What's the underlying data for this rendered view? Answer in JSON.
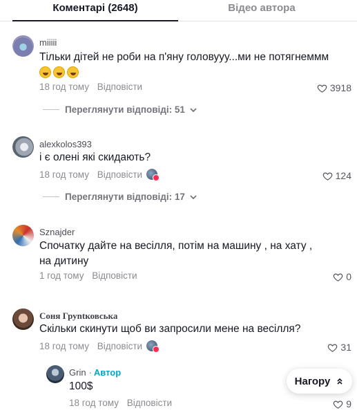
{
  "tabs": [
    {
      "label": "Коментарі (2648)",
      "active": true
    },
    {
      "label": "Відео автора",
      "active": false
    }
  ],
  "comments": [
    {
      "username": "miiiii",
      "text": "Тільки дітей не роби на п'яну головууу...ми не потягнеммм",
      "emojis": [
        "rolling-laughing-emoji",
        "rolling-laughing-emoji",
        "rolling-laughing-emoji"
      ],
      "time": "18 год тому",
      "reply_label": "Відповісти",
      "likes": "3918",
      "view_replies": "Переглянути відповіді: 51"
    },
    {
      "username": "alexkolos393",
      "text": "і є олені які скидають?",
      "time": "18 год тому",
      "reply_label": "Відповісти",
      "likes": "124",
      "view_replies": "Переглянути відповіді: 17"
    },
    {
      "username": "Sznajder",
      "text": "Спочатку дайте на весілля, потім на машину , на хату , на дитину",
      "time": "1 год тому",
      "reply_label": "Відповісти",
      "likes": "0"
    },
    {
      "username": "Соня Груntковська",
      "text": "Скільки скинути щоб ви запросили мене на весілля?",
      "time": "18 год тому",
      "reply_label": "Відповісти",
      "likes": "31"
    }
  ],
  "reply": {
    "username": "Grin",
    "author_label": "Автор",
    "text": "100$",
    "time": "18 год тому",
    "reply_label": "Відповісти",
    "likes": "9"
  },
  "back_to_top": "Нагору",
  "colors": {
    "accent_author": "#00a8c6",
    "badge_dot": "#fe2c55"
  }
}
